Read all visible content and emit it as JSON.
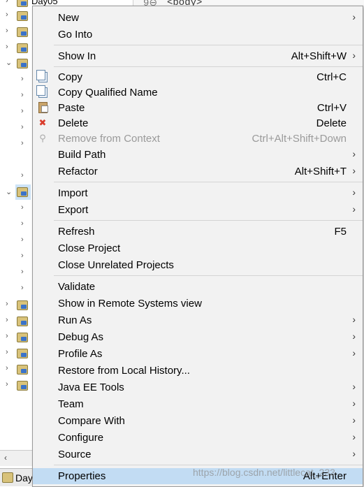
{
  "tree": {
    "top_label": "Day05",
    "bottom_tab_label": "Day"
  },
  "editor": {
    "gutter_text": "9⊖",
    "code_text": "<body>"
  },
  "menu": {
    "items": [
      {
        "label": "New",
        "shortcut": "",
        "submenu": true,
        "icon": ""
      },
      {
        "label": "Go Into",
        "shortcut": "",
        "submenu": false,
        "icon": ""
      },
      {
        "label": "Show In",
        "shortcut": "Alt+Shift+W",
        "submenu": true,
        "icon": ""
      },
      {
        "label": "Copy",
        "shortcut": "Ctrl+C",
        "submenu": false,
        "icon": "copy-icon"
      },
      {
        "label": "Copy Qualified Name",
        "shortcut": "",
        "submenu": false,
        "icon": "copy-qualified-icon"
      },
      {
        "label": "Paste",
        "shortcut": "Ctrl+V",
        "submenu": false,
        "icon": "paste-icon"
      },
      {
        "label": "Delete",
        "shortcut": "Delete",
        "submenu": false,
        "icon": "delete-icon"
      },
      {
        "label": "Remove from Context",
        "shortcut": "Ctrl+Alt+Shift+Down",
        "submenu": false,
        "icon": "remove-context-icon",
        "disabled": true
      },
      {
        "label": "Build Path",
        "shortcut": "",
        "submenu": true,
        "icon": ""
      },
      {
        "label": "Refactor",
        "shortcut": "Alt+Shift+T",
        "submenu": true,
        "icon": ""
      },
      {
        "label": "Import",
        "shortcut": "",
        "submenu": true,
        "icon": ""
      },
      {
        "label": "Export",
        "shortcut": "",
        "submenu": true,
        "icon": ""
      },
      {
        "label": "Refresh",
        "shortcut": "F5",
        "submenu": false,
        "icon": ""
      },
      {
        "label": "Close Project",
        "shortcut": "",
        "submenu": false,
        "icon": ""
      },
      {
        "label": "Close Unrelated Projects",
        "shortcut": "",
        "submenu": false,
        "icon": ""
      },
      {
        "label": "Validate",
        "shortcut": "",
        "submenu": false,
        "icon": ""
      },
      {
        "label": "Show in Remote Systems view",
        "shortcut": "",
        "submenu": false,
        "icon": ""
      },
      {
        "label": "Run As",
        "shortcut": "",
        "submenu": true,
        "icon": ""
      },
      {
        "label": "Debug As",
        "shortcut": "",
        "submenu": true,
        "icon": ""
      },
      {
        "label": "Profile As",
        "shortcut": "",
        "submenu": true,
        "icon": ""
      },
      {
        "label": "Restore from Local History...",
        "shortcut": "",
        "submenu": false,
        "icon": ""
      },
      {
        "label": "Java EE Tools",
        "shortcut": "",
        "submenu": true,
        "icon": ""
      },
      {
        "label": "Team",
        "shortcut": "",
        "submenu": true,
        "icon": ""
      },
      {
        "label": "Compare With",
        "shortcut": "",
        "submenu": true,
        "icon": ""
      },
      {
        "label": "Configure",
        "shortcut": "",
        "submenu": true,
        "icon": ""
      },
      {
        "label": "Source",
        "shortcut": "",
        "submenu": true,
        "icon": ""
      },
      {
        "label": "Properties",
        "shortcut": "Alt+Enter",
        "submenu": false,
        "icon": "",
        "highlighted": true
      }
    ]
  },
  "watermark": "https://blog.csdn.net/littlecat_233"
}
